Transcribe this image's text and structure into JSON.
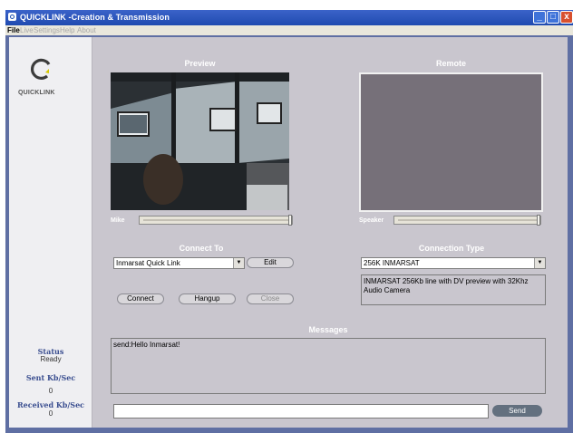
{
  "window": {
    "title": "QUICKLINK -Creation & Transmission",
    "minimize_glyph": "_",
    "maximize_glyph": "□",
    "close_glyph": "x"
  },
  "menu": [
    "File",
    "Live",
    "Settings",
    "Help",
    "About"
  ],
  "sidebar": {
    "logo_text": "QUICKLINK",
    "status_label": "Status",
    "status_value": "Ready",
    "sent_label": "Sent Kb/Sec",
    "sent_value": "0",
    "received_label": "Received Kb/Sec",
    "received_value": "0"
  },
  "preview": {
    "title": "Preview",
    "mike_label": "Mike"
  },
  "remote": {
    "title": "Remote",
    "speaker_label": "Speaker"
  },
  "connect_to": {
    "title": "Connect To",
    "selected": "Inmarsat Quick Link",
    "edit_label": "Edit"
  },
  "connection_type": {
    "title": "Connection Type",
    "selected": "256K INMARSAT",
    "description": "INMARSAT 256Kb line with DV preview with 32Khz Audio Camera"
  },
  "actions": {
    "connect_label": "Connect",
    "hangup_label": "Hangup",
    "close_label": "Close"
  },
  "messages": {
    "title": "Messages",
    "log": "send:Hello Inmarsat!",
    "input_value": "",
    "send_label": "Send"
  },
  "levels": {
    "mike_level": 1.0,
    "speaker_level": 1.0
  },
  "colors": {
    "accent": "#204bb0",
    "panel_bg": "#c9c6ce",
    "frame": "#5f6fa3"
  }
}
